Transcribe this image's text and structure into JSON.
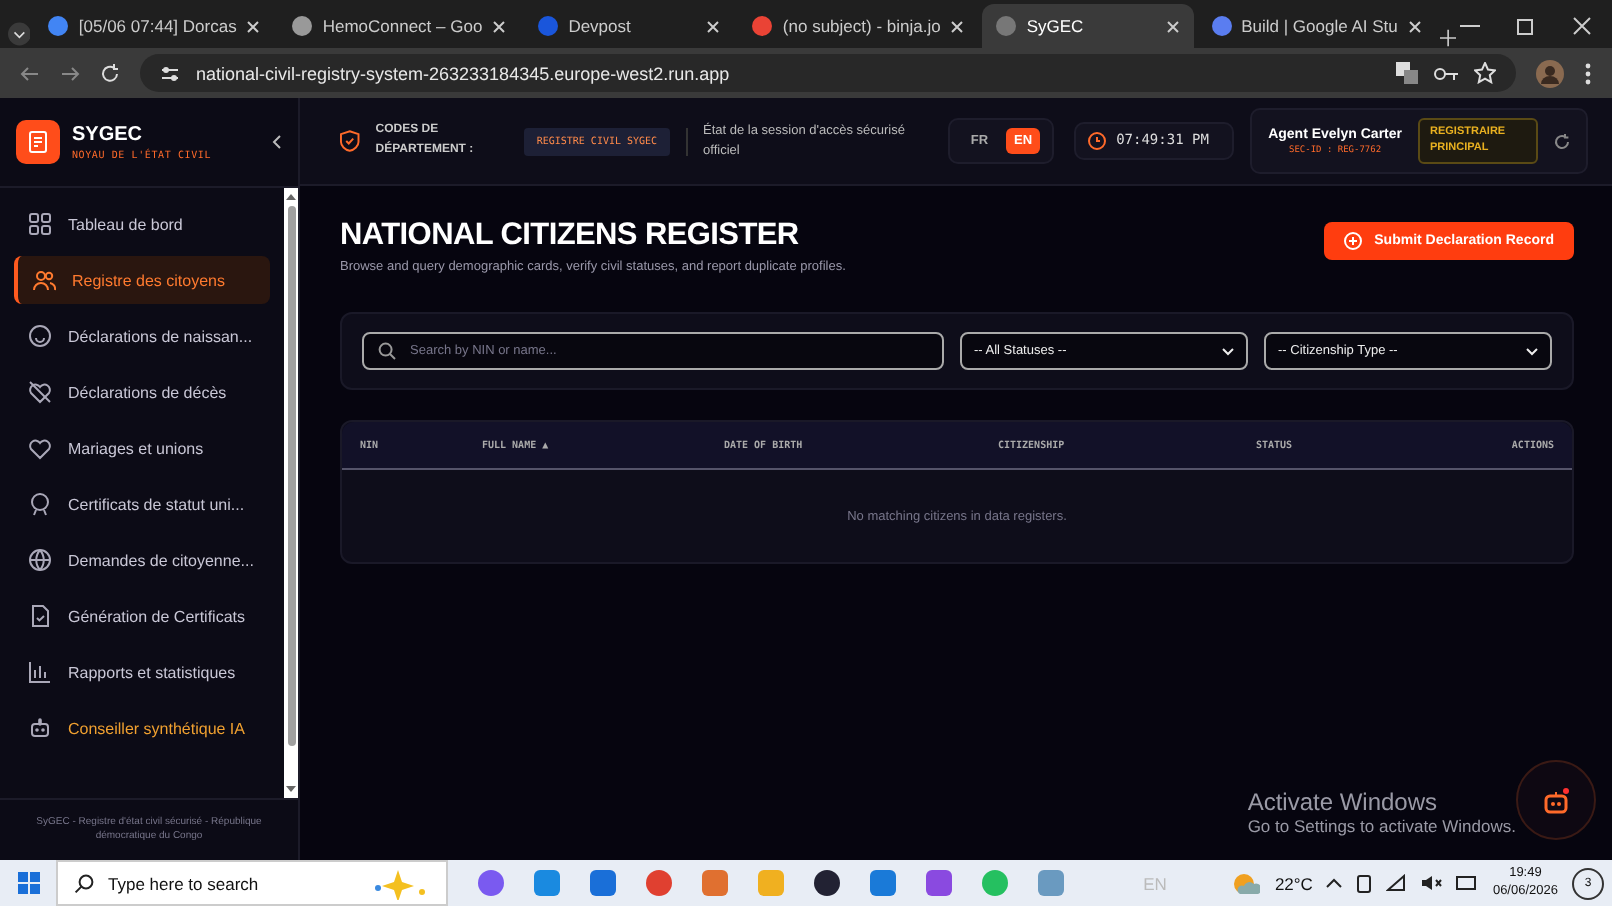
{
  "browser": {
    "tabs": [
      {
        "title": "[05/06 07:44] Dorcas",
        "selected": false
      },
      {
        "title": "HemoConnect – Goo",
        "selected": false
      },
      {
        "title": "Devpost",
        "selected": false
      },
      {
        "title": "(no subject) - binja.jo",
        "selected": false
      },
      {
        "title": "SyGEC",
        "selected": true
      },
      {
        "title": "Build | Google AI Stu",
        "selected": false
      }
    ],
    "url": "national-civil-registry-system-263233184345.europe-west2.run.app"
  },
  "sidebar": {
    "brand": "SYGEC",
    "subtitle": "NOYAU DE L'ÉTAT CIVIL",
    "items": [
      {
        "label": "Tableau de bord",
        "selected": false,
        "accent": false
      },
      {
        "label": "Registre des citoyens",
        "selected": true,
        "accent": false
      },
      {
        "label": "Déclarations de naissan...",
        "selected": false,
        "accent": false
      },
      {
        "label": "Déclarations de décès",
        "selected": false,
        "accent": false
      },
      {
        "label": "Mariages et unions",
        "selected": false,
        "accent": false
      },
      {
        "label": "Certificats de statut uni...",
        "selected": false,
        "accent": false
      },
      {
        "label": "Demandes de citoyenne...",
        "selected": false,
        "accent": false
      },
      {
        "label": "Génération de Certificats",
        "selected": false,
        "accent": false
      },
      {
        "label": "Rapports et statistiques",
        "selected": false,
        "accent": false
      },
      {
        "label": "Conseiller synthétique IA",
        "selected": false,
        "accent": true
      }
    ],
    "footer": "SyGEC - Registre d'état civil sécurisé - République démocratique du Congo"
  },
  "header": {
    "department_label": "CODES DE DÉPARTEMENT :",
    "department_code": "REGISTRE CIVIL SYGEC",
    "session_text": "État de la session d'accès sécurisé officiel",
    "languages": [
      {
        "label": "FR",
        "selected": false
      },
      {
        "label": "EN",
        "selected": true
      }
    ],
    "clock": "07:49:31 PM",
    "agent_name": "Agent Evelyn Carter",
    "agent_id": "SEC-ID : REG-7762",
    "role": "REGISTRAIRE PRINCIPAL"
  },
  "main": {
    "title": "NATIONAL CITIZENS REGISTER",
    "subtitle": "Browse and query demographic cards, verify civil statuses, and report duplicate profiles.",
    "action": "Submit Declaration Record",
    "search": {
      "placeholder": "Search by NIN or name..."
    },
    "filters": [
      "-- All Statuses --",
      "-- Citizenship Type --"
    ],
    "table": {
      "columns": [
        "NIN",
        "FULL NAME ▲",
        "DATE OF BIRTH",
        "CITIZENSHIP",
        "STATUS",
        "ACTIONS"
      ],
      "empty": "No matching citizens in data registers."
    }
  },
  "os_notice": {
    "title": "Activate Windows",
    "text": "Go to Settings to activate Windows."
  },
  "taskbar": {
    "search_placeholder": "Type here to search",
    "input_language": "EN",
    "weather": "22°C",
    "time": "19:49",
    "date": "06/06/2026",
    "notifications": "3"
  }
}
